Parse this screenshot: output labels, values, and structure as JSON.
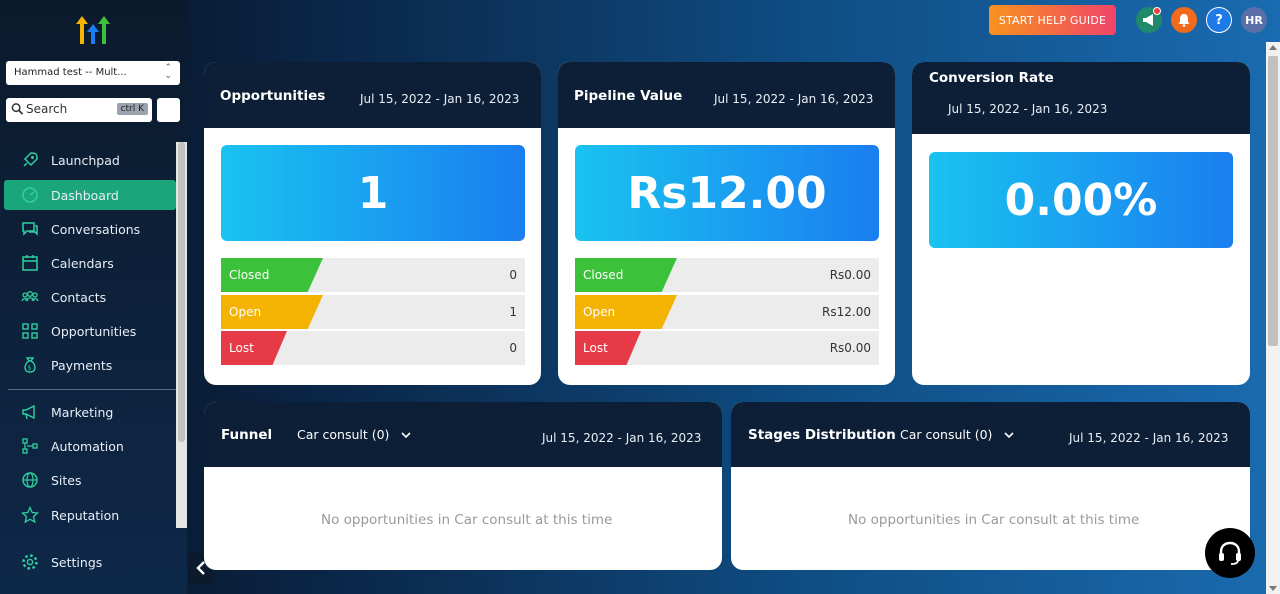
{
  "sidebar": {
    "account_label": "Hammad test -- Mult...",
    "search_placeholder": "Search",
    "search_shortcut": "ctrl K",
    "items": [
      {
        "label": "Launchpad",
        "icon": "rocket-icon"
      },
      {
        "label": "Dashboard",
        "icon": "gauge-icon",
        "active": true
      },
      {
        "label": "Conversations",
        "icon": "chat-icon"
      },
      {
        "label": "Calendars",
        "icon": "calendar-icon"
      },
      {
        "label": "Contacts",
        "icon": "contacts-icon"
      },
      {
        "label": "Opportunities",
        "icon": "grid-icon"
      },
      {
        "label": "Payments",
        "icon": "money-bag-icon"
      },
      {
        "label": "Marketing",
        "icon": "megaphone-icon"
      },
      {
        "label": "Automation",
        "icon": "automation-icon"
      },
      {
        "label": "Sites",
        "icon": "globe-icon"
      },
      {
        "label": "Reputation",
        "icon": "star-icon"
      },
      {
        "label": "Settings",
        "icon": "gear-icon"
      }
    ]
  },
  "topbar": {
    "help_guide_label": "START HELP GUIDE",
    "help_icon_label": "?",
    "avatar_initials": "HR"
  },
  "cards": {
    "opportunities": {
      "title": "Opportunities",
      "date_range": "Jul 15, 2022 - Jan 16, 2023",
      "big_value": "1",
      "rows": [
        {
          "label": "Closed",
          "value": "0"
        },
        {
          "label": "Open",
          "value": "1"
        },
        {
          "label": "Lost",
          "value": "0"
        }
      ]
    },
    "pipeline": {
      "title": "Pipeline Value",
      "date_range": "Jul 15, 2022 - Jan 16, 2023",
      "big_value": "Rs12.00",
      "rows": [
        {
          "label": "Closed",
          "value": "Rs0.00"
        },
        {
          "label": "Open",
          "value": "Rs12.00"
        },
        {
          "label": "Lost",
          "value": "Rs0.00"
        }
      ]
    },
    "conversion": {
      "title": "Conversion Rate",
      "date_range": "Jul 15, 2022 - Jan 16, 2023",
      "big_value": "0.00%"
    },
    "funnel": {
      "title": "Funnel",
      "pipeline_select": "Car consult (0)",
      "date_range": "Jul 15, 2022 - Jan 16, 2023",
      "empty_message": "No opportunities in Car consult at this time"
    },
    "stages": {
      "title": "Stages Distribution",
      "pipeline_select": "Car consult (0)",
      "date_range": "Jul 15, 2022 - Jan 16, 2023",
      "empty_message": "No opportunities in Car consult at this time"
    }
  },
  "colors": {
    "closed": "#3cc13b",
    "open": "#f5b301",
    "lost": "#e63a46",
    "active_nav": "#1aa67a",
    "card_header": "#0c1f36"
  }
}
